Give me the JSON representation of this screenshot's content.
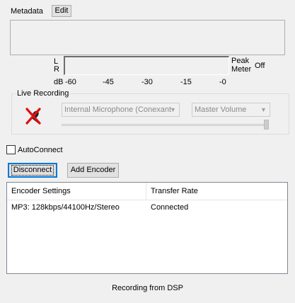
{
  "metadata": {
    "label": "Metadata",
    "edit_label": "Edit"
  },
  "meter": {
    "lr_top": "L",
    "lr_bottom": "R",
    "db_label": "dB",
    "scale": [
      "-60",
      "-45",
      "-30",
      "-15",
      "-0"
    ],
    "peak_label_1": "Peak",
    "peak_label_2": "Meter",
    "peak_state": "Off"
  },
  "live_recording": {
    "title": "Live Recording",
    "input_device": "Internal Microphone (Conexant",
    "mixer": "Master Volume"
  },
  "autoconnect": {
    "label": "AutoConnect",
    "checked": false
  },
  "buttons": {
    "disconnect": "Disconnect",
    "add_encoder": "Add Encoder"
  },
  "encoders": {
    "columns": [
      "Encoder Settings",
      "Transfer Rate"
    ],
    "rows": [
      [
        "MP3: 128kbps/44100Hz/Stereo",
        "Connected"
      ]
    ]
  },
  "status": "Recording from DSP"
}
